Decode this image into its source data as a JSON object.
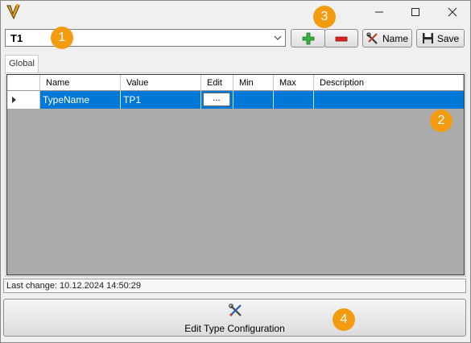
{
  "window": {
    "icons": {
      "app": "vi-logo-icon",
      "minimize": "minimize-icon",
      "maximize": "maximize-icon",
      "close": "close-icon"
    }
  },
  "type_selector": {
    "value": "T1",
    "icon": "chevron-down-icon"
  },
  "toolbar": {
    "add_icon": "plus-icon",
    "remove_icon": "minus-icon",
    "name_label": "Name",
    "name_icon": "tools-icon",
    "save_label": "Save",
    "save_icon": "floppy-disk-icon"
  },
  "tabs": [
    {
      "label": "Global"
    }
  ],
  "grid": {
    "columns": [
      {
        "label": ""
      },
      {
        "label": "Name"
      },
      {
        "label": "Value"
      },
      {
        "label": "Edit"
      },
      {
        "label": "Min"
      },
      {
        "label": "Max"
      },
      {
        "label": "Description"
      }
    ],
    "rows": [
      {
        "name": "TypeName",
        "value": "TP1",
        "edit_label": "...",
        "min": "",
        "max": "",
        "description": ""
      }
    ],
    "selected_color": "#0078d7",
    "empty_area_color": "#ababab"
  },
  "status": {
    "text": "Last change: 10.12.2024 14:50:29"
  },
  "edit_config_button": {
    "label": "Edit Type Configuration",
    "icon": "tools-icon"
  },
  "badges": [
    "1",
    "2",
    "3",
    "4"
  ],
  "badge_color": "#f39c12"
}
